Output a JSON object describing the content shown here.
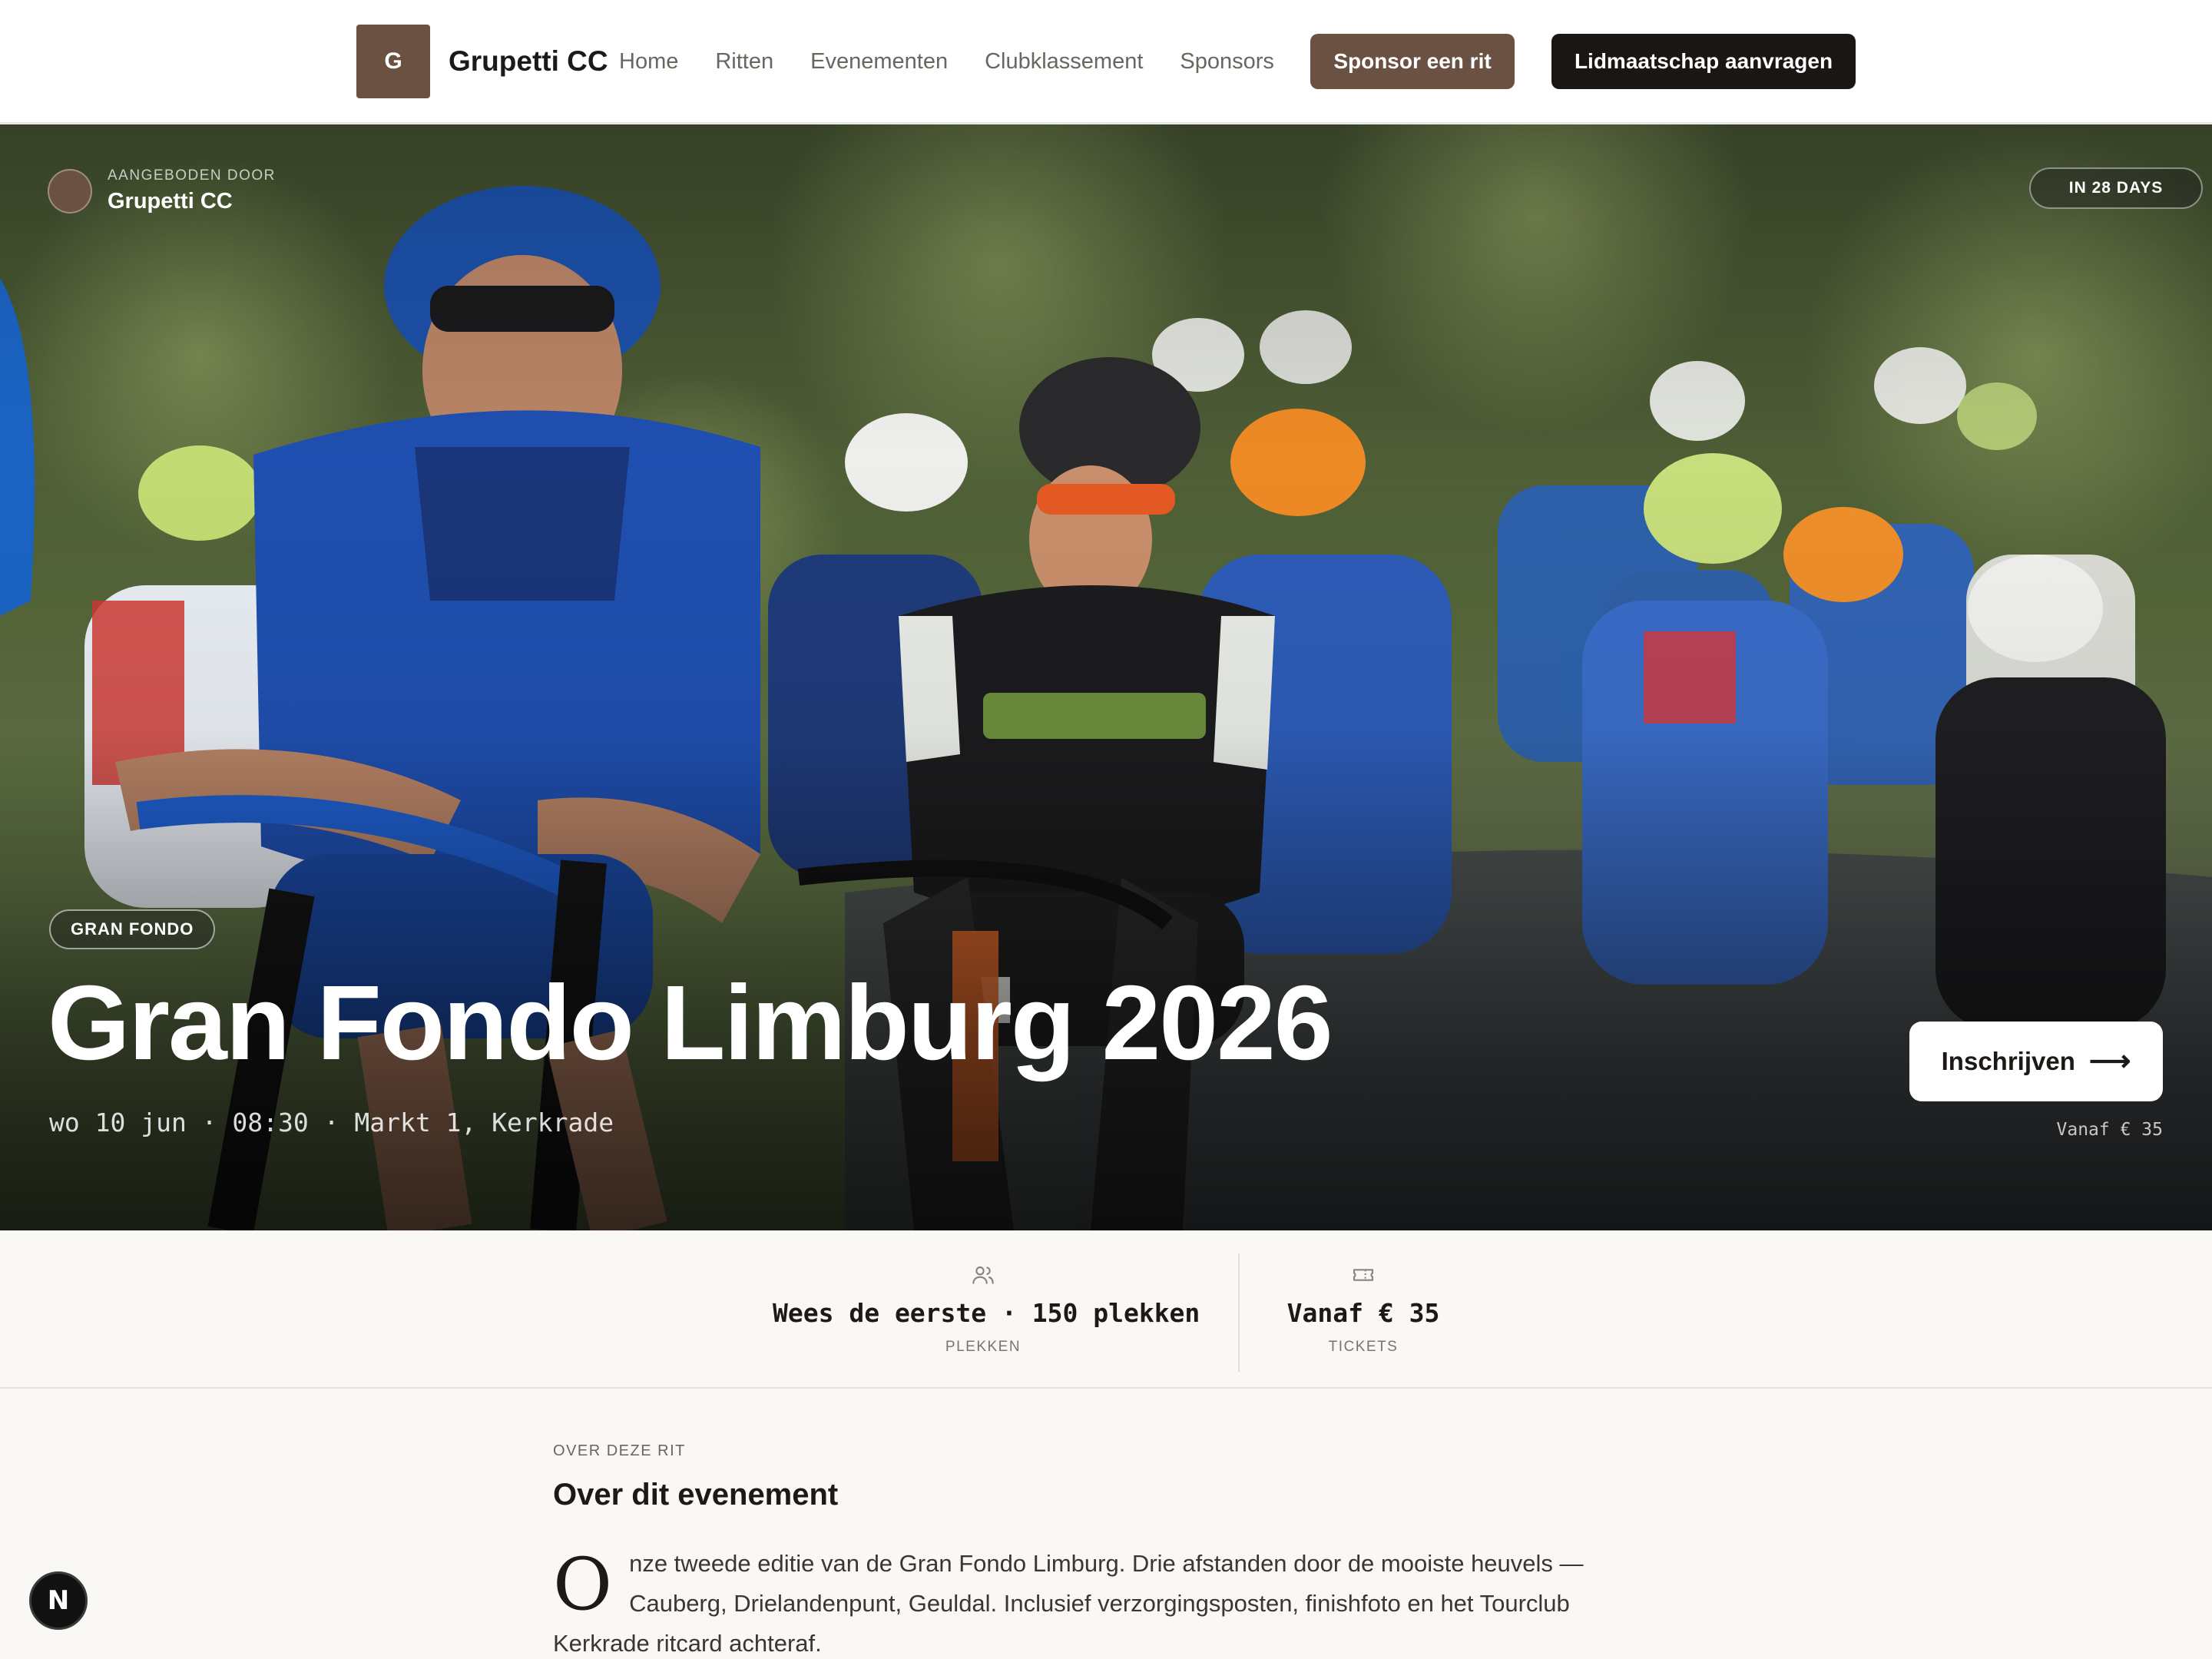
{
  "nav": {
    "logo_letter": "G",
    "brand_name": "Grupetti CC",
    "links": [
      {
        "label": "Home"
      },
      {
        "label": "Ritten"
      },
      {
        "label": "Evenementen"
      },
      {
        "label": "Clubklassement"
      },
      {
        "label": "Sponsors"
      }
    ],
    "sponsor_button": "Sponsor een rit",
    "membership_button": "Lidmaatschap aanvragen"
  },
  "hero": {
    "offered_by_label": "AANGEBODEN DOOR",
    "host_name": "Grupetti CC",
    "countdown": "IN 28 DAYS",
    "event_type": "GRAN FONDO",
    "title": "Gran Fondo Limburg 2026",
    "meta": "wo 10 jun · 08:30 · Markt 1, Kerkrade",
    "register_button": "Inschrijven",
    "price_note": "Vanaf € 35"
  },
  "stats": [
    {
      "icon": "users-icon",
      "value": "Wees de eerste · 150 plekken",
      "label": "PLEKKEN"
    },
    {
      "icon": "ticket-icon",
      "value": "Vanaf € 35",
      "label": "TICKETS"
    }
  ],
  "about": {
    "eyebrow": "OVER DEZE RIT",
    "title": "Over dit evenement",
    "drop_cap": "O",
    "body": "nze tweede editie van de Gran Fondo Limburg. Drie afstanden door de mooiste heuvels — Cauberg, Drielandenpunt, Geuldal. Inclusief verzorgingsposten, finishfoto en het Tourclub Kerkrade ritcard achteraf."
  },
  "dev_badge": {
    "letter": "N"
  },
  "colors": {
    "brand_brown": "#6b5142",
    "dark_button": "#1a1614",
    "page_bg": "#f9f8f5"
  }
}
